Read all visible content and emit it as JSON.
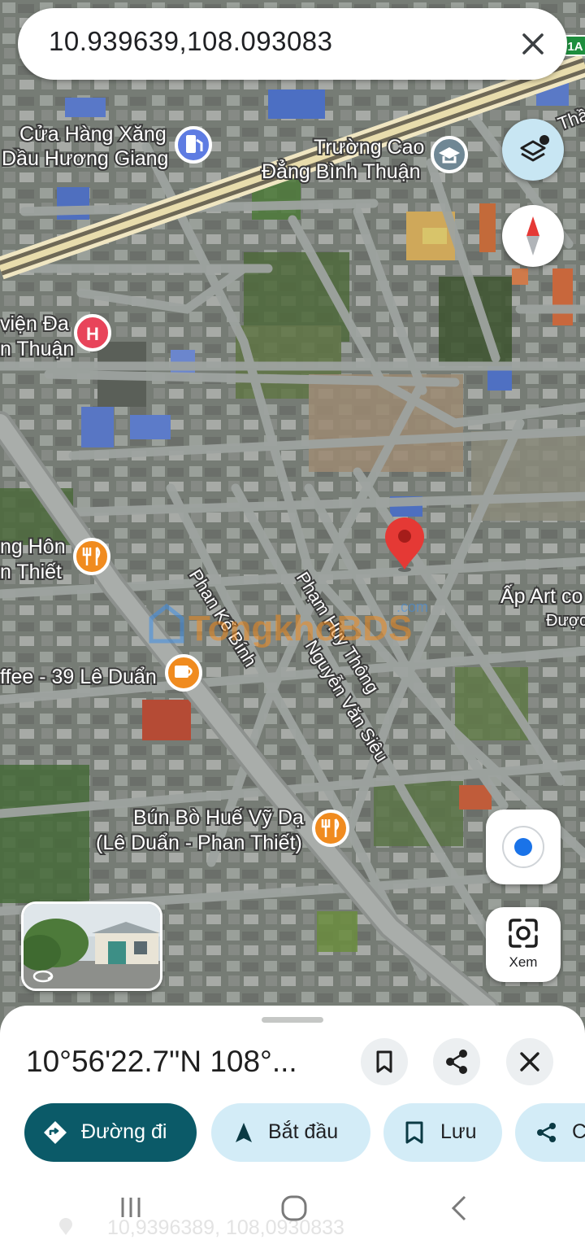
{
  "search": {
    "query": "10.939639,108.093083",
    "close_icon": "close-icon"
  },
  "map_labels": {
    "gas_station_line1": "Cửa Hàng Xăng",
    "gas_station_line2": "Dầu Hương Giang",
    "college_line1": "Trường Cao",
    "college_line2": "Đẳng Bình Thuận",
    "hospital_line1": "viện Đa",
    "hospital_line2": "n Thuận",
    "restaurant1_line1": "ng Hôn",
    "restaurant1_line2": "n Thiết",
    "street_phan_ke_binh": "Phan Kế Bính",
    "street_pham_huy_thong": "Phạm Huy Thông",
    "street_nguyen_van_sieu": "Nguyễn Văn Siêu",
    "cafe": "ffee - 39 Lê Duẩn",
    "bun_bo_line1": "Bún Bò Huế Vỹ Dạ",
    "bun_bo_line2": "(Lê Duẩn - Phan Thiết)",
    "ap_art_line1": "Ấp Art co",
    "ap_art_line2": "Được",
    "top_right_road": "Thầ",
    "highway_shield": "1A",
    "watermark": "TongkhoBDS",
    "watermark_com": ".com"
  },
  "controls": {
    "lens_label": "Xem"
  },
  "sheet": {
    "title": "10°56'22.7\"N 108°...",
    "chips": {
      "directions": "Đường đi",
      "start": "Bắt đầu",
      "save": "Lưu",
      "share_partial": "C"
    }
  },
  "ghost_text": "10,9396389, 108,0930833",
  "colors": {
    "accent_dark": "#0b5a68",
    "chip_light": "#d3ecf7",
    "pin_red": "#e53935",
    "restaurant_orange": "#f08b1f",
    "hospital_red": "#e8445a",
    "gas_blue": "#5e7ce2",
    "school_gray": "#6f8794",
    "locate_blue": "#1a73e8"
  }
}
